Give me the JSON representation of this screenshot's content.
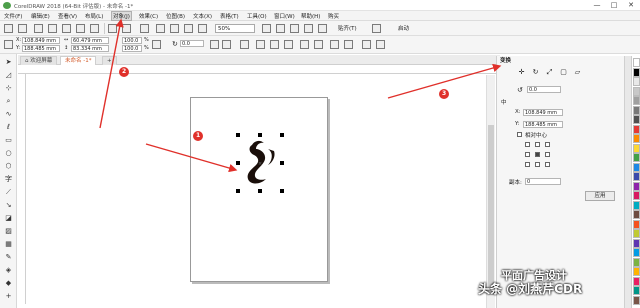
{
  "window": {
    "title": "CorelDRAW 2018 (64-Bit 评估版) - 未命名 -1*",
    "minimize_glyph": "—",
    "maximize_glyph": "□",
    "close_glyph": "✕"
  },
  "menubar": {
    "items": [
      "文件(F)",
      "编辑(E)",
      "查看(V)",
      "布局(L)",
      "对象(J)",
      "效果(C)",
      "位图(B)",
      "文本(X)",
      "表格(T)",
      "工具(O)",
      "窗口(W)",
      "帮助(H)",
      "购买"
    ],
    "highlighted": "对象(J)"
  },
  "toolbar": {
    "zoom": "50%",
    "snap_label": "贴齐(T)",
    "launch_label": "启动"
  },
  "propbar": {
    "x": "108.849 mm",
    "y": "188.485 mm",
    "width": "60.479 mm",
    "height": "83.334 mm",
    "scale_x": "100.0",
    "scale_y": "100.0",
    "percent": "%",
    "rotation": "0.0",
    "x_label": "X:",
    "y_label": "Y:"
  },
  "doctabs": {
    "welcome": "欢迎屏幕",
    "document": "未命名 -1*",
    "add": "+"
  },
  "docker": {
    "title": "变换",
    "rotation": "0.0",
    "center_label": "中",
    "x_label": "X:",
    "y_label": "Y:",
    "x": "108.849 mm",
    "y": "188.485 mm",
    "relative_center": "相对中心",
    "copies_label": "副本:",
    "copies": "0",
    "apply": "应用"
  },
  "annotations": {
    "marker1": "1",
    "marker2": "2",
    "marker3": "3",
    "arrow_color": "#e0302a"
  },
  "watermark": {
    "line1": "平面广告设计",
    "line2": "头条 @刘燕芹CDR"
  },
  "palette_colors": [
    "#ffffff",
    "#000000",
    "#e8e8e8",
    "#c8c8c8",
    "#a0a0a0",
    "#787878",
    "#505050",
    "#e53935",
    "#fb8c00",
    "#fdd835",
    "#43a047",
    "#1e88e5",
    "#3949ab",
    "#8e24aa",
    "#d81b60",
    "#00acc1",
    "#6d4c41",
    "#f4511e",
    "#c0ca33",
    "#5e35b1",
    "#039be5",
    "#7cb342",
    "#ffb300",
    "#e91e63",
    "#009688",
    "#795548"
  ]
}
